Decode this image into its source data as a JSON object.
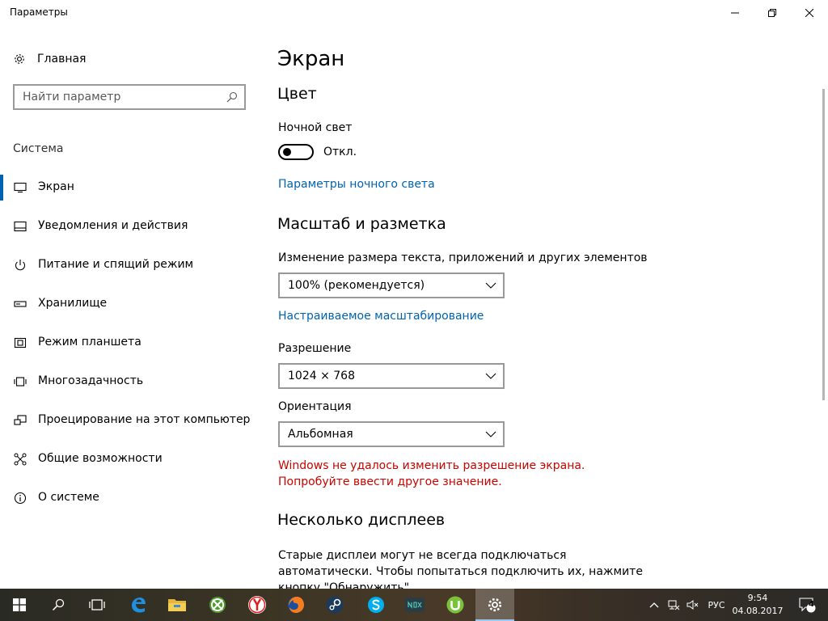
{
  "window": {
    "title": "Параметры"
  },
  "sidebar": {
    "home_label": "Главная",
    "search_placeholder": "Найти параметр",
    "section_label": "Система",
    "items": [
      {
        "label": "Экран",
        "icon": "monitor-icon"
      },
      {
        "label": "Уведомления и действия",
        "icon": "notifications-icon"
      },
      {
        "label": "Питание и спящий режим",
        "icon": "power-icon"
      },
      {
        "label": "Хранилище",
        "icon": "storage-icon"
      },
      {
        "label": "Режим планшета",
        "icon": "tablet-icon"
      },
      {
        "label": "Многозадачность",
        "icon": "multitasking-icon"
      },
      {
        "label": "Проецирование на этот компьютер",
        "icon": "projection-icon"
      },
      {
        "label": "Общие возможности",
        "icon": "shared-experiences-icon"
      },
      {
        "label": "О системе",
        "icon": "info-icon"
      }
    ]
  },
  "main": {
    "page_title": "Экран",
    "color_heading": "Цвет",
    "night_light_label": "Ночной свет",
    "night_light_state": "Откл.",
    "night_light_settings_link": "Параметры ночного света",
    "scale_heading": "Масштаб и разметка",
    "scale_label": "Изменение размера текста, приложений и других элементов",
    "scale_value": "100% (рекомендуется)",
    "custom_scaling_link": "Настраиваемое масштабирование",
    "resolution_label": "Разрешение",
    "resolution_value": "1024 × 768",
    "orientation_label": "Ориентация",
    "orientation_value": "Альбомная",
    "error_message": "Windows не удалось изменить разрешение экрана. Попробуйте ввести другое значение.",
    "multi_display_heading": "Несколько дисплеев",
    "multi_display_text": "Старые дисплеи могут не всегда подключаться автоматически. Чтобы попытаться подключить их, нажмите кнопку \"Обнаружить\"."
  },
  "taskbar": {
    "apps": [
      "start-icon",
      "search-icon",
      "task-view-icon",
      "edge-icon",
      "file-explorer-icon",
      "utorrent-green-icon",
      "yandex-browser-icon",
      "firefox-icon",
      "steam-icon",
      "skype-icon",
      "nox-icon",
      "utorrent-icon",
      "settings-icon"
    ],
    "language": "РУС",
    "time": "9:54",
    "date": "04.08.2017",
    "notification_count": "4"
  },
  "colors": {
    "accent": "#0063b1",
    "error": "#c50500",
    "taskbar_active_underline": "#9cc8ef"
  }
}
